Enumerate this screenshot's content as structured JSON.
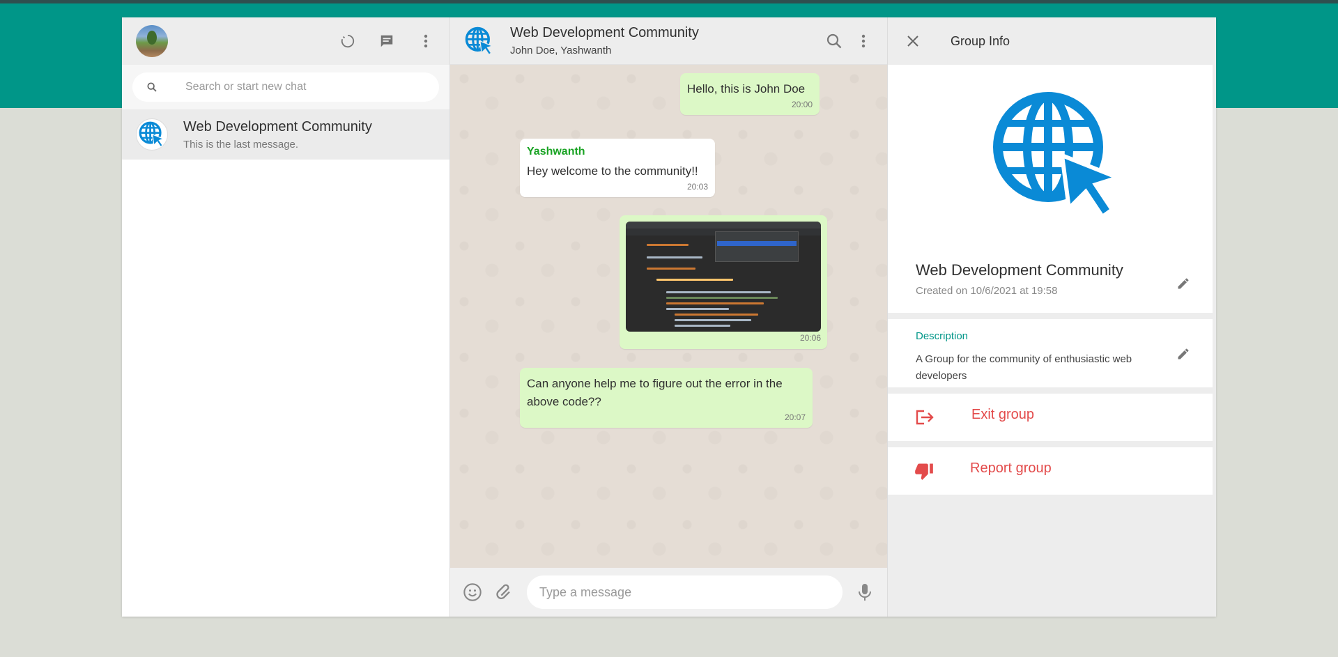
{
  "sidebar": {
    "search_placeholder": "Search or start new chat",
    "chats": [
      {
        "name": "Web Development Community",
        "last_message": "This is the last message."
      }
    ]
  },
  "chat": {
    "title": "Web Development Community",
    "subtitle": "John Doe, Yashwanth",
    "messages": [
      {
        "type": "out",
        "text": "Hello, this is John Doe",
        "time": "20:00"
      },
      {
        "type": "in",
        "sender": "Yashwanth",
        "text": "Hey welcome to the community!!",
        "time": "20:03"
      },
      {
        "type": "out-image",
        "time": "20:06"
      },
      {
        "type": "out",
        "text": "Can anyone help me to figure out the error in the above code??",
        "time": "20:07"
      }
    ],
    "input_placeholder": "Type a message"
  },
  "info": {
    "title": "Group Info",
    "group_name": "Web Development Community",
    "created": "Created on 10/6/2021 at 19:58",
    "description_label": "Description",
    "description": "A Group for the community of enthusiastic web developers",
    "exit_label": "Exit group",
    "report_label": "Report group"
  },
  "colors": {
    "accent": "#009688",
    "danger": "#e34b4b",
    "globe": "#0a8ad6",
    "outgoing_bubble": "#dcf8c6",
    "sender_name": "#1aa324"
  }
}
